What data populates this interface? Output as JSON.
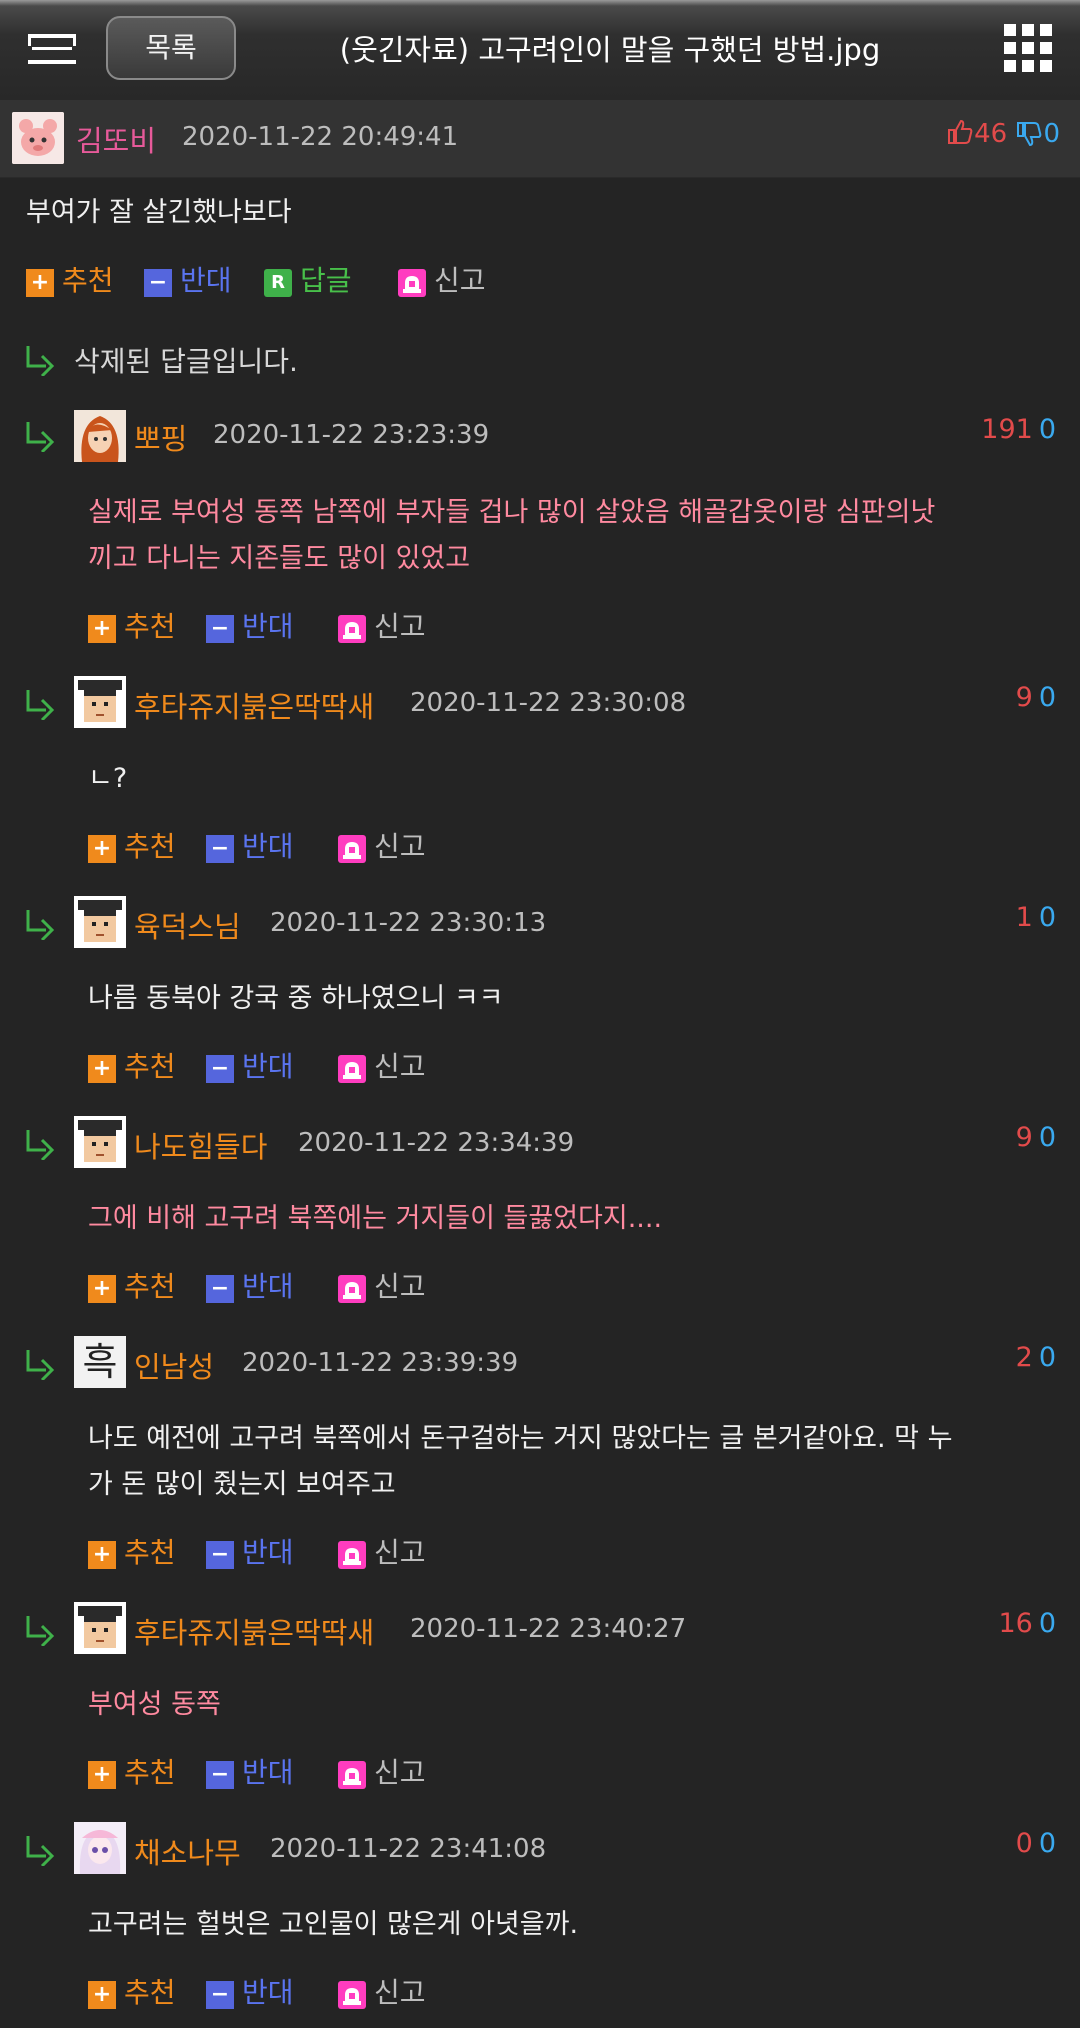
{
  "header": {
    "list_label": "목록",
    "title": "(웃긴자료) 고구려인이 말을 구했던 방법.jpg"
  },
  "post": {
    "author": "김또비",
    "date": "2020-11-22 20:49:41",
    "likes": "46",
    "dislikes": "0",
    "body": "부여가 잘 살긴했나보다"
  },
  "actions": {
    "recommend": "추천",
    "oppose": "반대",
    "reply": "답글",
    "report": "신고",
    "reply_icon_letter": "R"
  },
  "deleted_reply": "삭제된 답글입니다.",
  "comments": [
    {
      "author": "뽀핑",
      "date": "2020-11-22 23:23:39",
      "up": "191",
      "down": "0",
      "lines": [
        "실제로 부여성 동쪽 남쪽에 부자들 겁나 많이 살았음 해골갑옷이랑 심판의낫",
        "끼고 다니는 지존들도 많이 있었고"
      ]
    },
    {
      "author": "후타쥬지붉은딱딱새",
      "date": "2020-11-22 23:30:08",
      "up": "9",
      "down": "0",
      "lines": [
        "ㄴ?"
      ]
    },
    {
      "author": "육덕스님",
      "date": "2020-11-22 23:30:13",
      "up": "1",
      "down": "0",
      "lines": [
        "나름 동북아 강국 중 하나였으니 ㅋㅋ"
      ]
    },
    {
      "author": "나도힘들다",
      "date": "2020-11-22 23:34:39",
      "up": "9",
      "down": "0",
      "lines": [
        "그에 비해 고구려 북쪽에는 거지들이 들끓었다지...."
      ]
    },
    {
      "author": "인남성",
      "date": "2020-11-22 23:39:39",
      "up": "2",
      "down": "0",
      "lines": [
        "나도 예전에 고구려 북쪽에서 돈구걸하는 거지 많았다는 글 본거같아요. 막 누",
        "가 돈 많이 줬는지 보여주고"
      ]
    },
    {
      "author": "후타쥬지붉은딱딱새",
      "date": "2020-11-22 23:40:27",
      "up": "16",
      "down": "0",
      "lines": [
        "부여성 동쪽"
      ]
    },
    {
      "author": "채소나무",
      "date": "2020-11-22 23:41:08",
      "up": "0",
      "down": "0",
      "lines": [
        "고구려는 헐벗은 고인물이 많은게 아녓을까."
      ]
    }
  ],
  "avatar_glyphs": {
    "insungnam": "흑"
  },
  "colors": {
    "background": "#242424",
    "author_pink": "#e75a9a",
    "author_orange": "#f08a1c",
    "upvote_red": "#e24b4b",
    "downvote_blue": "#3aa9ef",
    "body_pink": "#ff8aa0"
  }
}
